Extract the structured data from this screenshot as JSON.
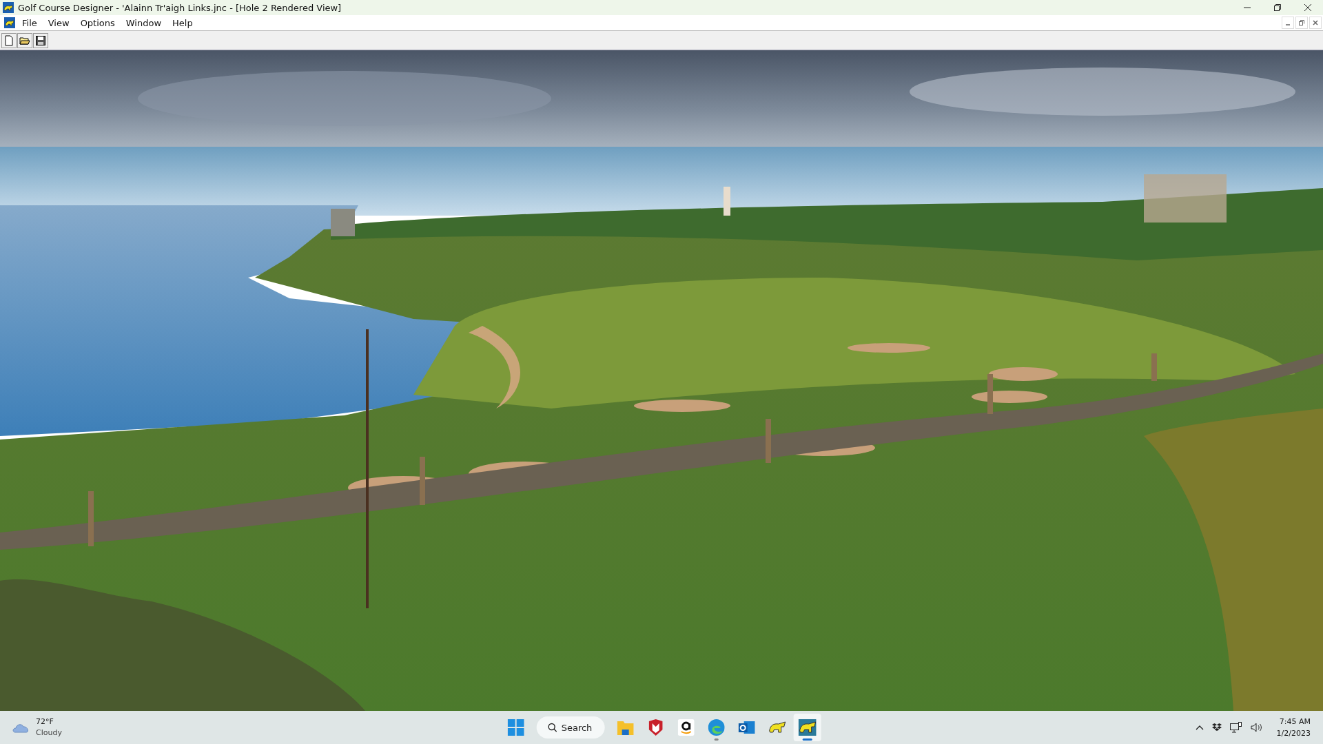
{
  "window": {
    "title": "Golf Course Designer - 'Alainn Tr'aigh Links.jnc - [Hole 2 Rendered View]"
  },
  "menu": [
    "File",
    "View",
    "Options",
    "Window",
    "Help"
  ],
  "taskbar": {
    "weather": {
      "temperature": "72°F",
      "condition": "Cloudy"
    },
    "search": {
      "label": "Search"
    },
    "apps": [
      {
        "kind": "start",
        "running": false,
        "selected": false
      },
      {
        "kind": "folder",
        "running": false,
        "selected": false
      },
      {
        "kind": "shield",
        "running": false,
        "selected": false
      },
      {
        "kind": "letter",
        "running": false,
        "selected": false
      },
      {
        "kind": "browser",
        "running": true,
        "selected": false
      },
      {
        "kind": "mail",
        "running": false,
        "selected": false
      },
      {
        "kind": "bear",
        "running": false,
        "selected": false
      },
      {
        "kind": "bear-framed",
        "running": true,
        "selected": true
      }
    ],
    "clock": {
      "time": "7:45 AM",
      "date": "1/2/2023"
    }
  }
}
